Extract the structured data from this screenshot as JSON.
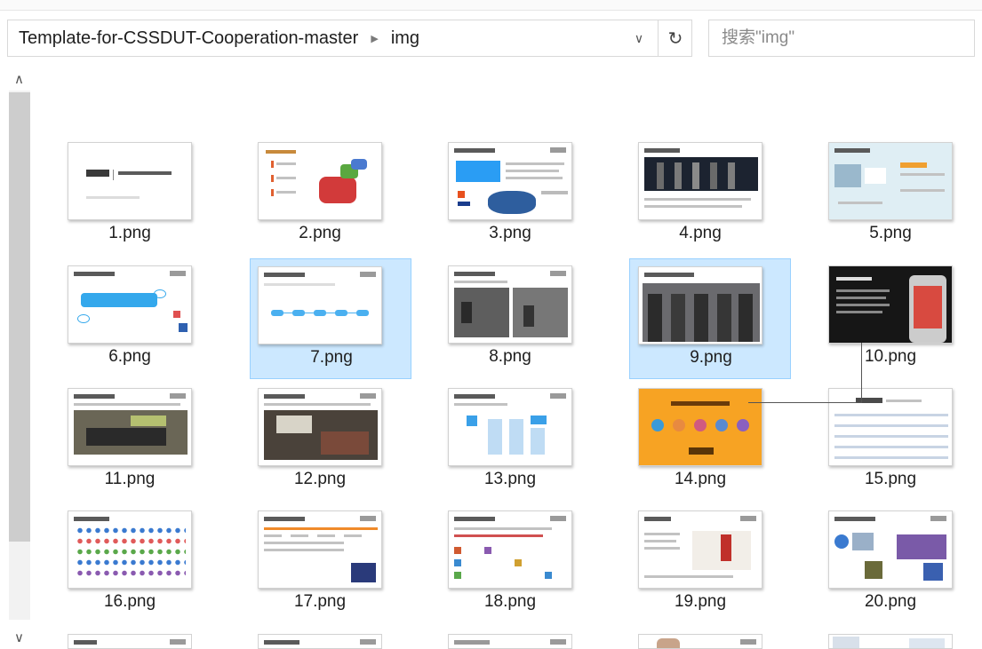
{
  "address": {
    "crumbs": [
      "Template-for-CSSDUT-Cooperation-master",
      "img"
    ],
    "separator_icon": "chevron-right-icon",
    "dropdown_icon": "chevron-down-icon",
    "refresh_icon": "refresh-icon"
  },
  "search": {
    "placeholder": "搜索\"img\""
  },
  "scrollbar": {
    "up_icon": "chevron-up-icon",
    "down_icon": "chevron-down-icon"
  },
  "files": [
    {
      "name": "1.png",
      "selected": false
    },
    {
      "name": "2.png",
      "selected": false
    },
    {
      "name": "3.png",
      "selected": false
    },
    {
      "name": "4.png",
      "selected": false
    },
    {
      "name": "5.png",
      "selected": false
    },
    {
      "name": "6.png",
      "selected": false
    },
    {
      "name": "7.png",
      "selected": true
    },
    {
      "name": "8.png",
      "selected": false
    },
    {
      "name": "9.png",
      "selected": true
    },
    {
      "name": "10.png",
      "selected": false
    },
    {
      "name": "11.png",
      "selected": false
    },
    {
      "name": "12.png",
      "selected": false
    },
    {
      "name": "13.png",
      "selected": false
    },
    {
      "name": "14.png",
      "selected": false
    },
    {
      "name": "15.png",
      "selected": false
    },
    {
      "name": "16.png",
      "selected": false
    },
    {
      "name": "17.png",
      "selected": false
    },
    {
      "name": "18.png",
      "selected": false
    },
    {
      "name": "19.png",
      "selected": false
    },
    {
      "name": "20.png",
      "selected": false
    }
  ],
  "colors": {
    "selection_fill": "#cce8ff",
    "selection_border": "#99d1ff",
    "accent_orange": "#f7a323"
  }
}
